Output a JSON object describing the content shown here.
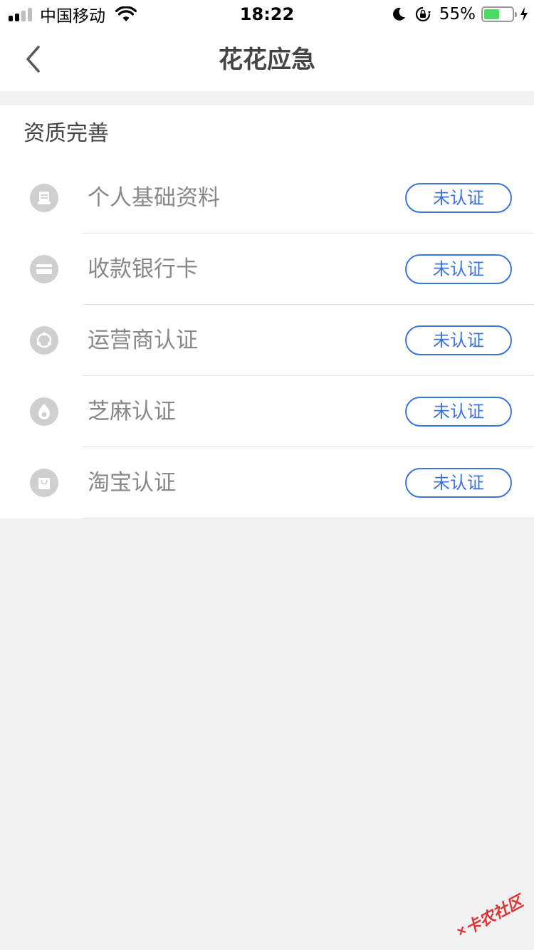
{
  "status_bar": {
    "carrier": "中国移动",
    "time": "18:22",
    "battery_percent": "55%",
    "battery_level": 0.55
  },
  "nav": {
    "title": "花花应急"
  },
  "section": {
    "title": "资质完善"
  },
  "items": [
    {
      "label": "个人基础资料",
      "status": "未认证",
      "icon": "profile-icon"
    },
    {
      "label": "收款银行卡",
      "status": "未认证",
      "icon": "bank-card-icon"
    },
    {
      "label": "运营商认证",
      "status": "未认证",
      "icon": "carrier-icon"
    },
    {
      "label": "芝麻认证",
      "status": "未认证",
      "icon": "sesame-icon"
    },
    {
      "label": "淘宝认证",
      "status": "未认证",
      "icon": "taobao-icon"
    }
  ],
  "watermark": {
    "text": "卡农社区"
  },
  "colors": {
    "accent": "#3a74e0",
    "battery": "#4cd964",
    "background": "#f1f1f1",
    "watermark": "#dd3333"
  }
}
